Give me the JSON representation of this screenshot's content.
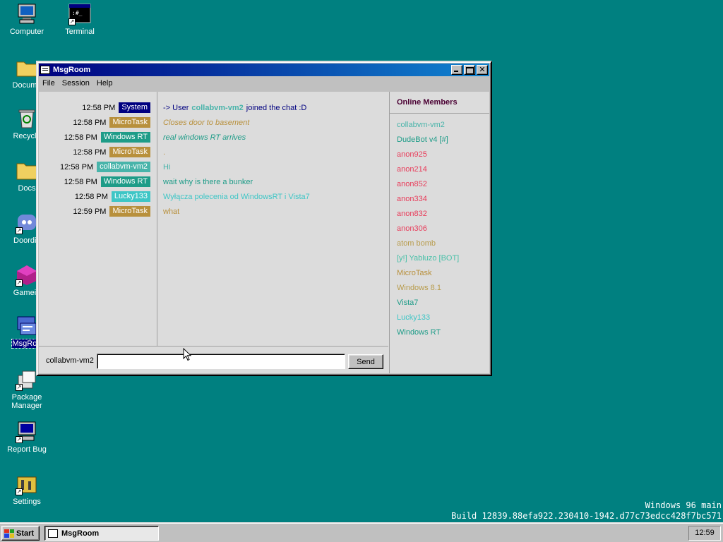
{
  "colors": {
    "desktop": "#008080",
    "system": "#000080",
    "microtask": "#b8903c",
    "windows_rt": "#1e9c88",
    "collabvm": "#48b4aa",
    "lucky": "#3ec6c6",
    "anon": "#e83c5a",
    "atom": "#b89c4c",
    "yabluzo": "#48c0a8",
    "dudebot": "#1e9c88",
    "vista": "#1e9c88"
  },
  "desktop": {
    "icons": [
      {
        "label": "Computer",
        "icon": "computer-icon"
      },
      {
        "label": "Terminal",
        "icon": "terminal-icon"
      },
      {
        "label": "Docume",
        "icon": "documents-folder-icon"
      },
      {
        "label": "Recycle",
        "icon": "recycle-bin-icon"
      },
      {
        "label": "Docs",
        "icon": "docs-folder-icon"
      },
      {
        "label": "Doordis",
        "icon": "doordis-icon"
      },
      {
        "label": "Gamein",
        "icon": "gamein-icon"
      },
      {
        "label": "MsgRoo",
        "icon": "msgroom-icon"
      },
      {
        "label": "Package Manager",
        "icon": "package-manager-icon"
      },
      {
        "label": "Report Bug",
        "icon": "report-bug-icon"
      },
      {
        "label": "Settings",
        "icon": "settings-icon"
      }
    ]
  },
  "window": {
    "title": "MsgRoom",
    "menu": [
      "File",
      "Session",
      "Help"
    ]
  },
  "messages": [
    {
      "time": "12:58 PM",
      "user": "System",
      "color": "#000080",
      "text_prefix": "-> User",
      "text_highlight": "collabvm-vm2",
      "text_suffix": "joined the chat :D",
      "text_color": "#000080",
      "italic": false
    },
    {
      "time": "12:58 PM",
      "user": "MicroTask",
      "color": "#b8903c",
      "text": "Closes door to basement",
      "text_color": "#b8903c",
      "italic": true
    },
    {
      "time": "12:58 PM",
      "user": "Windows RT",
      "color": "#1e9c88",
      "text": "real windows RT arrives",
      "text_color": "#1e9c88",
      "italic": true
    },
    {
      "time": "12:58 PM",
      "user": "MicroTask",
      "color": "#b8903c",
      "text": ".",
      "text_color": "#b8903c",
      "italic": false
    },
    {
      "time": "12:58 PM",
      "user": "collabvm-vm2",
      "color": "#48b4aa",
      "text": "Hi",
      "text_color": "#48b4aa",
      "italic": false
    },
    {
      "time": "12:58 PM",
      "user": "Windows RT",
      "color": "#1e9c88",
      "text": "wait why is there a bunker",
      "text_color": "#1e9c88",
      "italic": false
    },
    {
      "time": "12:58 PM",
      "user": "Lucky133",
      "color": "#3ec6c6",
      "text": "Wyłącza polecenia od WindowsRT i Vista7",
      "text_color": "#3ec6c6",
      "italic": false
    },
    {
      "time": "12:59 PM",
      "user": "MicroTask",
      "color": "#b8903c",
      "text": "what",
      "text_color": "#b8903c",
      "italic": false
    }
  ],
  "members": {
    "heading": "Online Members",
    "list": [
      {
        "name": "collabvm-vm2",
        "color": "#48b4aa"
      },
      {
        "name": "DudeBot v4 [#]",
        "color": "#1e9c88"
      },
      {
        "name": "anon925",
        "color": "#e83c5a"
      },
      {
        "name": "anon214",
        "color": "#e83c5a"
      },
      {
        "name": "anon852",
        "color": "#e83c5a"
      },
      {
        "name": "anon334",
        "color": "#e83c5a"
      },
      {
        "name": "anon832",
        "color": "#e83c5a"
      },
      {
        "name": "anon306",
        "color": "#e83c5a"
      },
      {
        "name": "atom bomb",
        "color": "#b89c4c"
      },
      {
        "name": "[y!] Yabluzo [BOT]",
        "color": "#48c0a8"
      },
      {
        "name": "MicroTask",
        "color": "#b8903c"
      },
      {
        "name": "Windows 8.1",
        "color": "#b89c4c"
      },
      {
        "name": "Vista7",
        "color": "#1e9c88"
      },
      {
        "name": "Lucky133",
        "color": "#3ec6c6"
      },
      {
        "name": "Windows RT",
        "color": "#1e9c88"
      }
    ]
  },
  "composer": {
    "username": "collabvm-vm2",
    "value": "",
    "send_label": "Send"
  },
  "watermark": {
    "line1": "Windows 96 main",
    "line2": "Build 12839.88efa922.230410-1942.d77c73edcc428f7bc571"
  },
  "taskbar": {
    "start_label": "Start",
    "task_label": "MsgRoom",
    "clock": "12:59"
  }
}
